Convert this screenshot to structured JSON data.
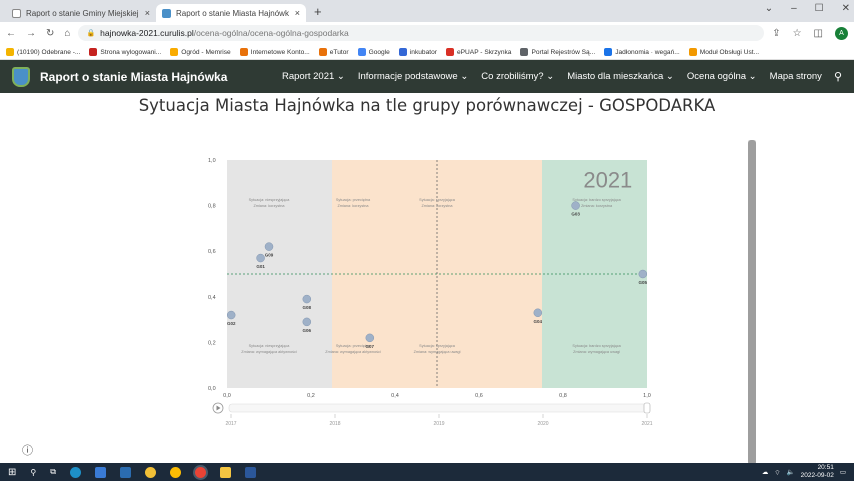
{
  "tabs": [
    {
      "label": "Raport o stanie Gminy Miejskiej",
      "active": false,
      "close": "×"
    },
    {
      "label": "Raport o stanie Miasta Hajnówk",
      "active": true,
      "close": "×"
    }
  ],
  "new_tab": "+",
  "url": {
    "host": "hajnowka-2021.curulis.pl",
    "path": "/ocena-ogólna/ocena-ogólna-gospodarka"
  },
  "profile_initial": "A",
  "bookmarks": [
    {
      "label": "(10190) Odebrane -...",
      "color": "#f4b400"
    },
    {
      "label": "Strona wylogowani...",
      "color": "#c5221f"
    },
    {
      "label": "Ogród - Memrise",
      "color": "#f9ab00"
    },
    {
      "label": "Internetowe Konto...",
      "color": "#e8710a"
    },
    {
      "label": "eTutor",
      "color": "#e8710a"
    },
    {
      "label": "Google",
      "color": "#4285f4"
    },
    {
      "label": "inkubator",
      "color": "#3367d6"
    },
    {
      "label": "ePUAP - Skrzynka",
      "color": "#d93025"
    },
    {
      "label": "Portal Rejestrów Są...",
      "color": "#5f6368"
    },
    {
      "label": "Jadłonomia · wegań...",
      "color": "#1a73e8"
    },
    {
      "label": "Moduł Obsługi Ust...",
      "color": "#f29900"
    }
  ],
  "site": {
    "brand": "Raport o stanie Miasta Hajnówka",
    "menu": [
      "Raport 2021 ⌄",
      "Informacje podstawowe ⌄",
      "Co zrobiliśmy? ⌄",
      "Miasto dla mieszkańca ⌄",
      "Ocena ogólna ⌄",
      "Mapa strony"
    ]
  },
  "page_title": "Sytuacja Miasta Hajnówka na tle grupy porównawczej - GOSPODARKA",
  "chart_data": {
    "type": "scatter",
    "year_label": "2021",
    "xlim": [
      0,
      1
    ],
    "ylim": [
      0,
      1
    ],
    "xticks": [
      "0,0",
      "0,2",
      "0,4",
      "0,6",
      "0,8",
      "1,0"
    ],
    "yticks": [
      "0,0",
      "0,2",
      "0,4",
      "0,6",
      "0,8",
      "1,0"
    ],
    "threshold": 0.5,
    "quadrant_colors": [
      "#e5e5e5",
      "#fbe3cc",
      "#fbe3cc",
      "#c8e3d4"
    ],
    "quadrant_labels": [
      {
        "x": 0.1,
        "y": 0.82,
        "line1": "Sytuacja: niesprzyjająca",
        "line2": "Zmiana: korzystna"
      },
      {
        "x": 0.3,
        "y": 0.82,
        "line1": "Sytuacja: przeciętna",
        "line2": "Zmiana: korzystna"
      },
      {
        "x": 0.5,
        "y": 0.82,
        "line1": "Sytuacja: sprzyjająca",
        "line2": "Zmiana: korzystna"
      },
      {
        "x": 0.88,
        "y": 0.82,
        "line1": "Sytuacja: bardzo sprzyjająca",
        "line2": "Zmiana: korzystna"
      },
      {
        "x": 0.1,
        "y": 0.18,
        "line1": "Sytuacja: niesprzyjająca",
        "line2": "Zmiana: wymagająca aktywności"
      },
      {
        "x": 0.3,
        "y": 0.18,
        "line1": "Sytuacja: przeciętna",
        "line2": "Zmiana: wymagająca aktywności"
      },
      {
        "x": 0.5,
        "y": 0.18,
        "line1": "Sytuacja: sprzyjająca",
        "line2": "Zmiana: wymagająca uwagi"
      },
      {
        "x": 0.88,
        "y": 0.18,
        "line1": "Sytuacja: bardzo sprzyjająca",
        "line2": "Zmiana: wymagająca uwagi"
      }
    ],
    "points": [
      {
        "label": "G01",
        "x": 0.08,
        "y": 0.57
      },
      {
        "label": "G09",
        "x": 0.1,
        "y": 0.62
      },
      {
        "label": "G02",
        "x": 0.01,
        "y": 0.32
      },
      {
        "label": "G08",
        "x": 0.19,
        "y": 0.39
      },
      {
        "label": "G06",
        "x": 0.19,
        "y": 0.29
      },
      {
        "label": "G07",
        "x": 0.34,
        "y": 0.22
      },
      {
        "label": "G04",
        "x": 0.74,
        "y": 0.33
      },
      {
        "label": "G03",
        "x": 0.83,
        "y": 0.8
      },
      {
        "label": "G05",
        "x": 0.99,
        "y": 0.5
      }
    ],
    "timeline": [
      "2017",
      "2018",
      "2019",
      "2020",
      "2021"
    ],
    "timeline_value": "2021"
  },
  "info_icon": "ⓘ",
  "taskbar_time": "20:51",
  "taskbar_date": "2022-09-02"
}
